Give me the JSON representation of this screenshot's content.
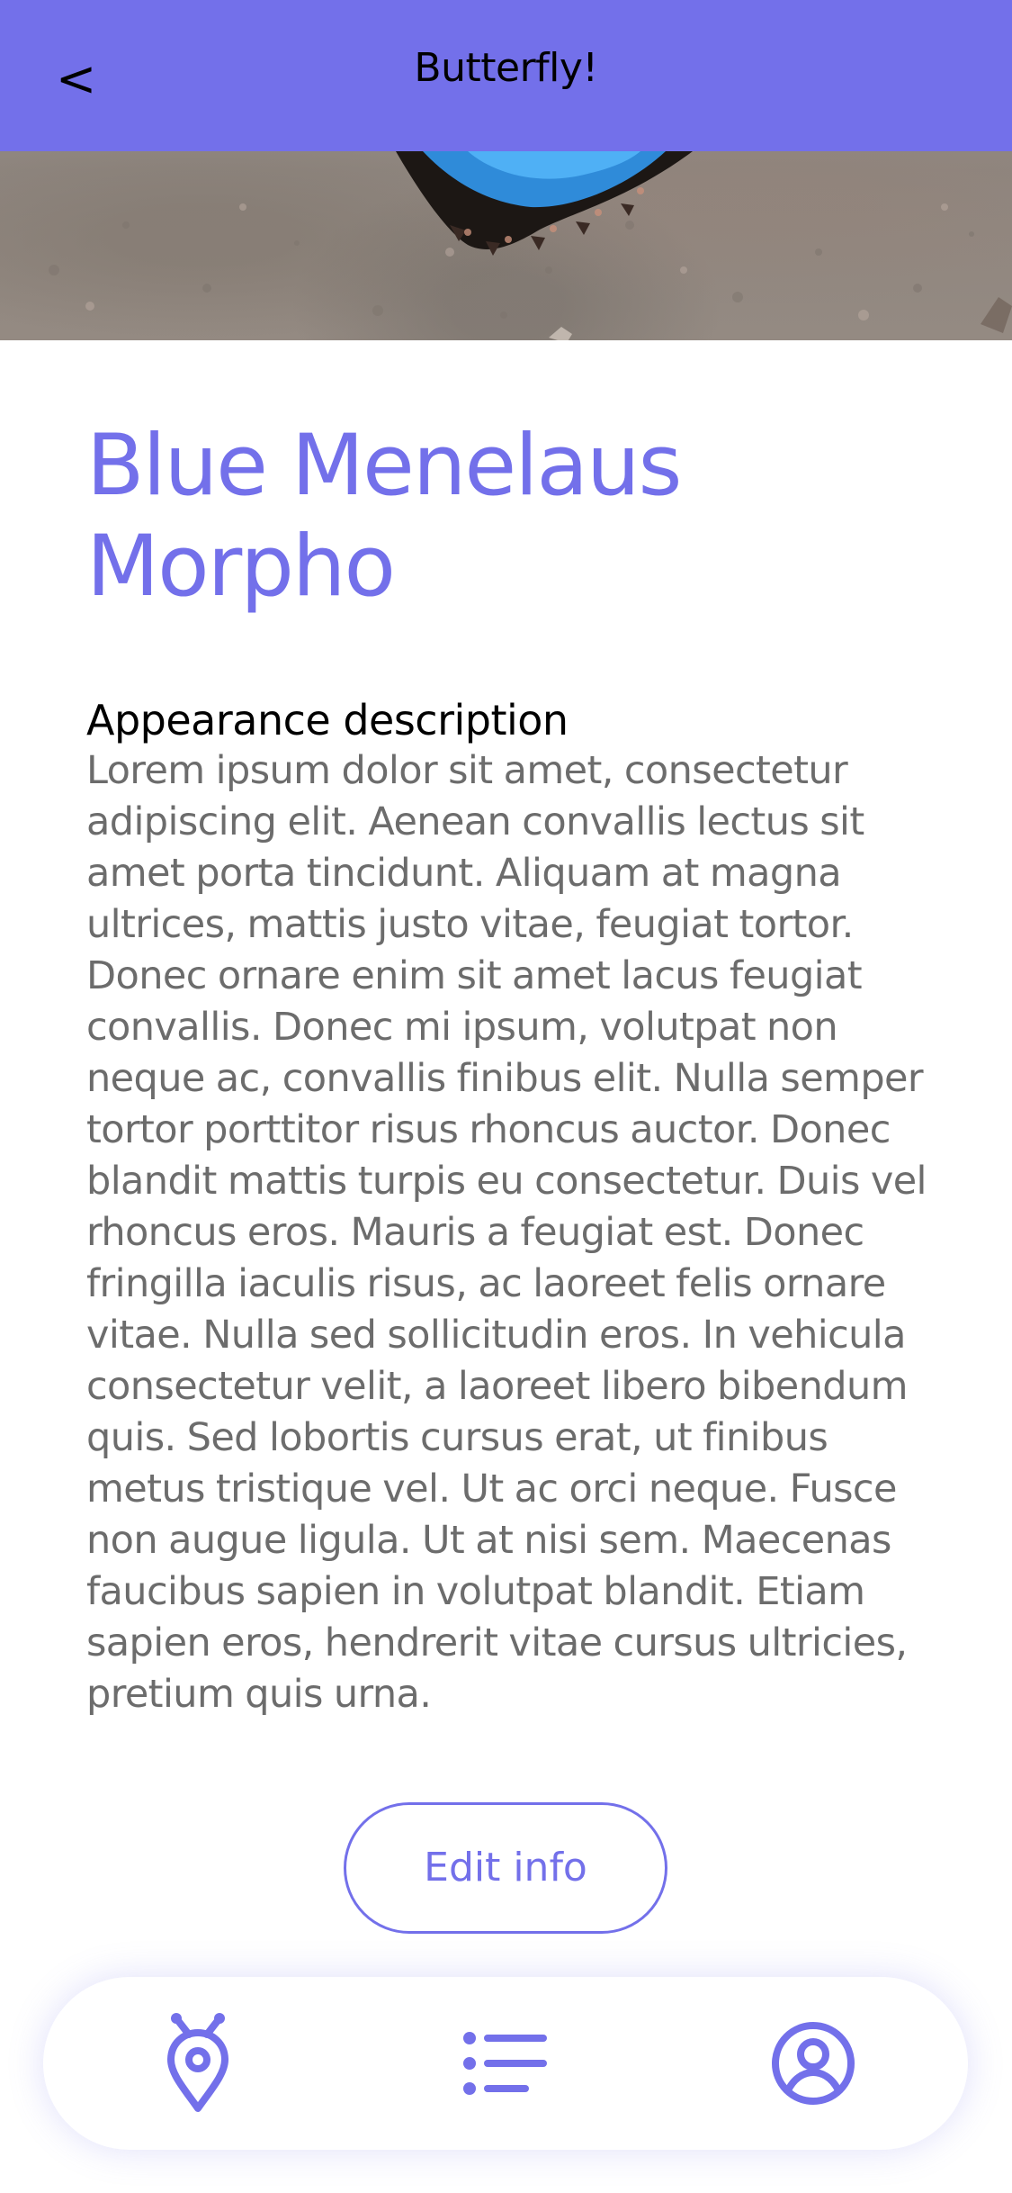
{
  "header": {
    "title": "Butterfly!",
    "back_label": "<"
  },
  "species": {
    "name": "Blue Menelaus Morpho"
  },
  "appearance": {
    "heading": "Appearance description",
    "text": "Lorem ipsum dolor sit amet, consectetur adipiscing elit. Aenean convallis lectus sit amet porta tincidunt. Aliquam at magna ultrices, mattis justo vitae, feugiat tortor. Donec ornare enim sit amet lacus feugiat convallis. Donec mi ipsum, volutpat non neque ac, convallis finibus elit. Nulla semper tortor porttitor risus rhoncus auctor. Donec blandit mattis turpis eu consectetur. Duis vel rhoncus eros. Mauris a feugiat est. Donec fringilla iaculis risus, ac laoreet felis ornare vitae. Nulla sed sollicitudin eros. In vehicula consectetur velit, a laoreet libero bibendum quis. Sed lobortis cursus erat, ut finibus metus tristique vel. Ut ac orci neque. Fusce non augue ligula. Ut at nisi sem. Maecenas faucibus sapien in volutpat blandit. Etiam sapien eros, hendrerit vitae cursus ultricies, pretium quis urna."
  },
  "actions": {
    "edit_label": "Edit info"
  },
  "bottom_nav": {
    "items": [
      {
        "icon": "butterfly-location-icon"
      },
      {
        "icon": "list-icon"
      },
      {
        "icon": "profile-icon"
      }
    ]
  },
  "colors": {
    "accent": "#7370ea",
    "body_text": "#6c6c6c",
    "heading_text": "#000000"
  }
}
